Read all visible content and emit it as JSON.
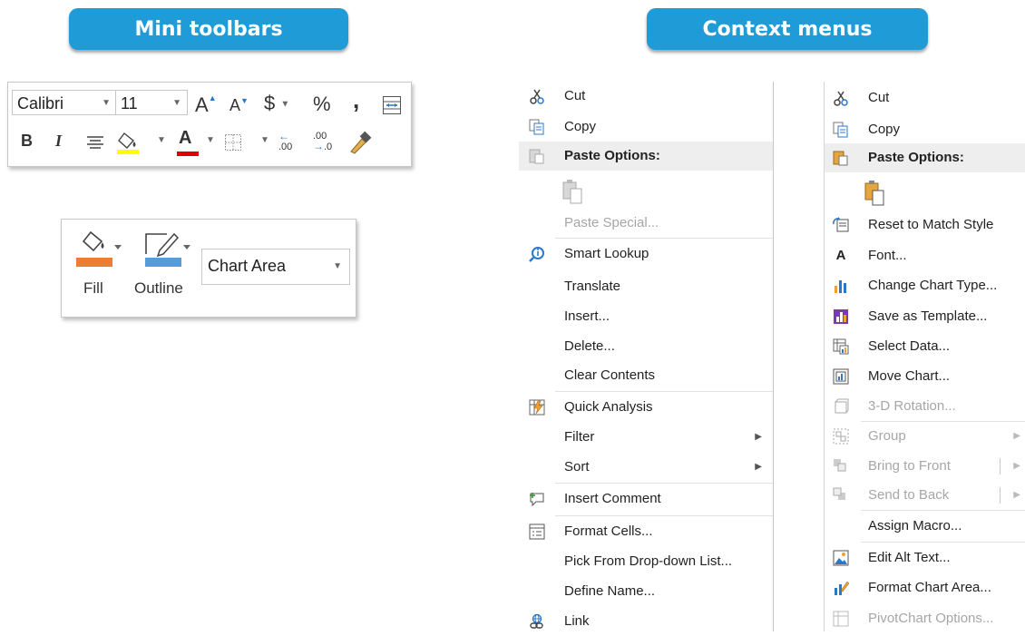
{
  "headers": {
    "mini": "Mini toolbars",
    "context": "Context menus"
  },
  "toolbar1": {
    "font_name": "Calibri",
    "font_size": "11",
    "increase_font": "A",
    "decrease_font": "A",
    "currency": "$",
    "percent": "%",
    "comma": ",",
    "bold": "B",
    "italic": "I",
    "font_color_letter": "A",
    "decimal_inc": ".00",
    "decimal_dec": ".0",
    "fill_color": "#ffff00",
    "font_color": "#e00000"
  },
  "toolbar2": {
    "fill_label": "Fill",
    "outline_label": "Outline",
    "chart_element": "Chart Area",
    "fill_color": "#ed7d31",
    "outline_color": "#5b9bd5"
  },
  "menu1": {
    "items": [
      {
        "label": "Cut",
        "icon": "scissors-icon"
      },
      {
        "label": "Copy",
        "icon": "copy-icon"
      },
      {
        "label": "Paste Options:",
        "icon": "paste-icon"
      },
      {
        "label": "",
        "icon": "paste-icon"
      },
      {
        "label": "Paste Special...",
        "icon": ""
      },
      {
        "label": "Smart Lookup",
        "icon": "smart-lookup-icon"
      },
      {
        "label": "Translate",
        "icon": ""
      },
      {
        "label": "Insert...",
        "icon": ""
      },
      {
        "label": "Delete...",
        "icon": ""
      },
      {
        "label": "Clear Contents",
        "icon": ""
      },
      {
        "label": "Quick Analysis",
        "icon": "quick-analysis-icon"
      },
      {
        "label": "Filter",
        "icon": ""
      },
      {
        "label": "Sort",
        "icon": ""
      },
      {
        "label": "Insert Comment",
        "icon": "comment-icon"
      },
      {
        "label": "Format Cells...",
        "icon": "format-cells-icon"
      },
      {
        "label": "Pick From Drop-down List...",
        "icon": ""
      },
      {
        "label": "Define Name...",
        "icon": ""
      },
      {
        "label": "Link",
        "icon": "link-icon"
      }
    ]
  },
  "menu2": {
    "items": [
      {
        "label": "Cut",
        "icon": "scissors-icon"
      },
      {
        "label": "Copy",
        "icon": "copy-icon"
      },
      {
        "label": "Paste Options:",
        "icon": "paste-icon"
      },
      {
        "label": "",
        "icon": "paste-icon"
      },
      {
        "label": "Reset to Match Style",
        "icon": "reset-style-icon"
      },
      {
        "label": "Font...",
        "icon": "font-icon"
      },
      {
        "label": "Change Chart Type...",
        "icon": "chart-type-icon"
      },
      {
        "label": "Save as Template...",
        "icon": "template-icon"
      },
      {
        "label": "Select Data...",
        "icon": "select-data-icon"
      },
      {
        "label": "Move Chart...",
        "icon": "move-chart-icon"
      },
      {
        "label": "3-D Rotation...",
        "icon": "rotation-icon"
      },
      {
        "label": "Group",
        "icon": "group-icon"
      },
      {
        "label": "Bring to Front",
        "icon": "bring-front-icon"
      },
      {
        "label": "Send to Back",
        "icon": "send-back-icon"
      },
      {
        "label": "Assign Macro...",
        "icon": ""
      },
      {
        "label": "Edit Alt Text...",
        "icon": "alt-text-icon"
      },
      {
        "label": "Format Chart Area...",
        "icon": "format-chart-icon"
      },
      {
        "label": "PivotChart Options...",
        "icon": "pivot-icon"
      }
    ]
  }
}
